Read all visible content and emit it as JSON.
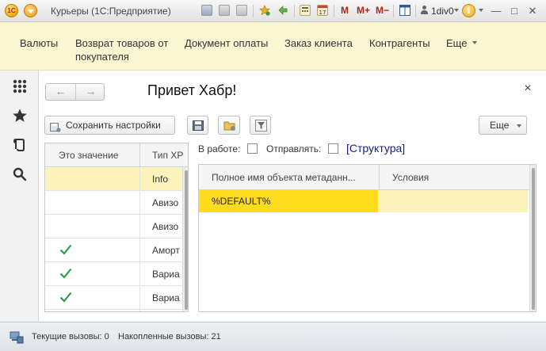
{
  "titlebar": {
    "title": "Курьеры (1С:Предприятие)",
    "m_buttons": [
      "M",
      "M+",
      "M−"
    ],
    "user": "1div0",
    "info_glyph": "i",
    "minimize": "—",
    "maximize": "□",
    "close": "✕"
  },
  "sections": [
    {
      "label": "Валюты"
    },
    {
      "label": "Возврат товаров от покупателя"
    },
    {
      "label": "Документ оплаты"
    },
    {
      "label": "Заказ клиента"
    },
    {
      "label": "Контрагенты"
    },
    {
      "label": "Еще"
    }
  ],
  "sidebar": {
    "icons": [
      "apps-grid-icon",
      "star-icon",
      "history-icon",
      "search-icon"
    ]
  },
  "form": {
    "nav_back": "←",
    "nav_forward": "→",
    "title": "Привет Хабр!",
    "close": "×",
    "toolbar": {
      "save_settings": "Сохранить настройки",
      "more": "Еще"
    },
    "left_table": {
      "columns": [
        "Это значение",
        "Тип ХР"
      ],
      "rows": [
        {
          "checked": false,
          "type": "Info",
          "selected": true
        },
        {
          "checked": false,
          "type": "Авизо",
          "selected": false
        },
        {
          "checked": false,
          "type": "Авизо",
          "selected": false
        },
        {
          "checked": true,
          "type": "Аморт",
          "selected": false
        },
        {
          "checked": true,
          "type": "Вариа",
          "selected": false
        },
        {
          "checked": true,
          "type": "Вариа",
          "selected": false
        }
      ]
    },
    "flags": {
      "in_work_label": "В работе:",
      "send_label": "Отправлять:",
      "structure_link": "[Структура]"
    },
    "right_table": {
      "columns": [
        "Полное имя объекта метаданн...",
        "Условия"
      ],
      "rows": [
        {
          "name": "%DEFAULT%",
          "conditions": ""
        }
      ]
    }
  },
  "status": {
    "current_calls": "Текущие вызовы: 0",
    "accumulated_calls": "Накопленные вызовы: 21"
  },
  "colors": {
    "section_panel": "#fbf6d2",
    "selected_row": "#fcf3ba",
    "selected_cell": "#fedc1d",
    "check_green": "#1e9a3a"
  }
}
